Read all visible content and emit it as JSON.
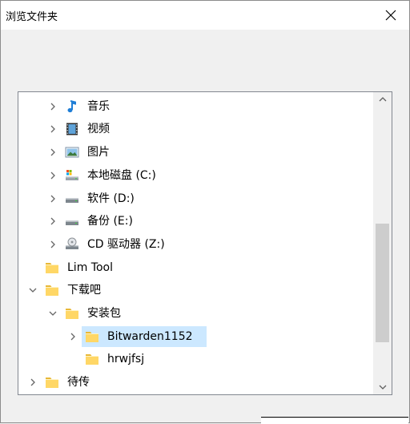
{
  "window": {
    "title": "浏览文件夹"
  },
  "tree": {
    "items": [
      {
        "label": "音乐",
        "icon": "music-icon",
        "chevron": "right"
      },
      {
        "label": "视频",
        "icon": "video-icon",
        "chevron": "right"
      },
      {
        "label": "图片",
        "icon": "pictures-icon",
        "chevron": "right"
      },
      {
        "label": "本地磁盘 (C:)",
        "icon": "system-drive-icon",
        "chevron": "right"
      },
      {
        "label": "软件 (D:)",
        "icon": "drive-icon",
        "chevron": "right"
      },
      {
        "label": "备份 (E:)",
        "icon": "drive-icon",
        "chevron": "right"
      },
      {
        "label": "CD 驱动器 (Z:)",
        "icon": "cd-drive-icon",
        "chevron": "right"
      },
      {
        "label": "Lim Tool",
        "icon": "folder-icon",
        "chevron": "none"
      },
      {
        "label": "下载吧",
        "icon": "folder-icon",
        "chevron": "down"
      },
      {
        "label": "安装包",
        "icon": "folder-icon",
        "chevron": "down"
      },
      {
        "label": "Bitwarden1152",
        "icon": "folder-icon",
        "chevron": "right",
        "selected": true
      },
      {
        "label": "hrwjfsj",
        "icon": "folder-icon",
        "chevron": "none"
      },
      {
        "label": "待传",
        "icon": "folder-icon",
        "chevron": "right"
      }
    ]
  },
  "colors": {
    "selection": "#cce8ff",
    "folder": "#ffd766",
    "folder_dark": "#e8b838",
    "panel_border": "#828790"
  }
}
